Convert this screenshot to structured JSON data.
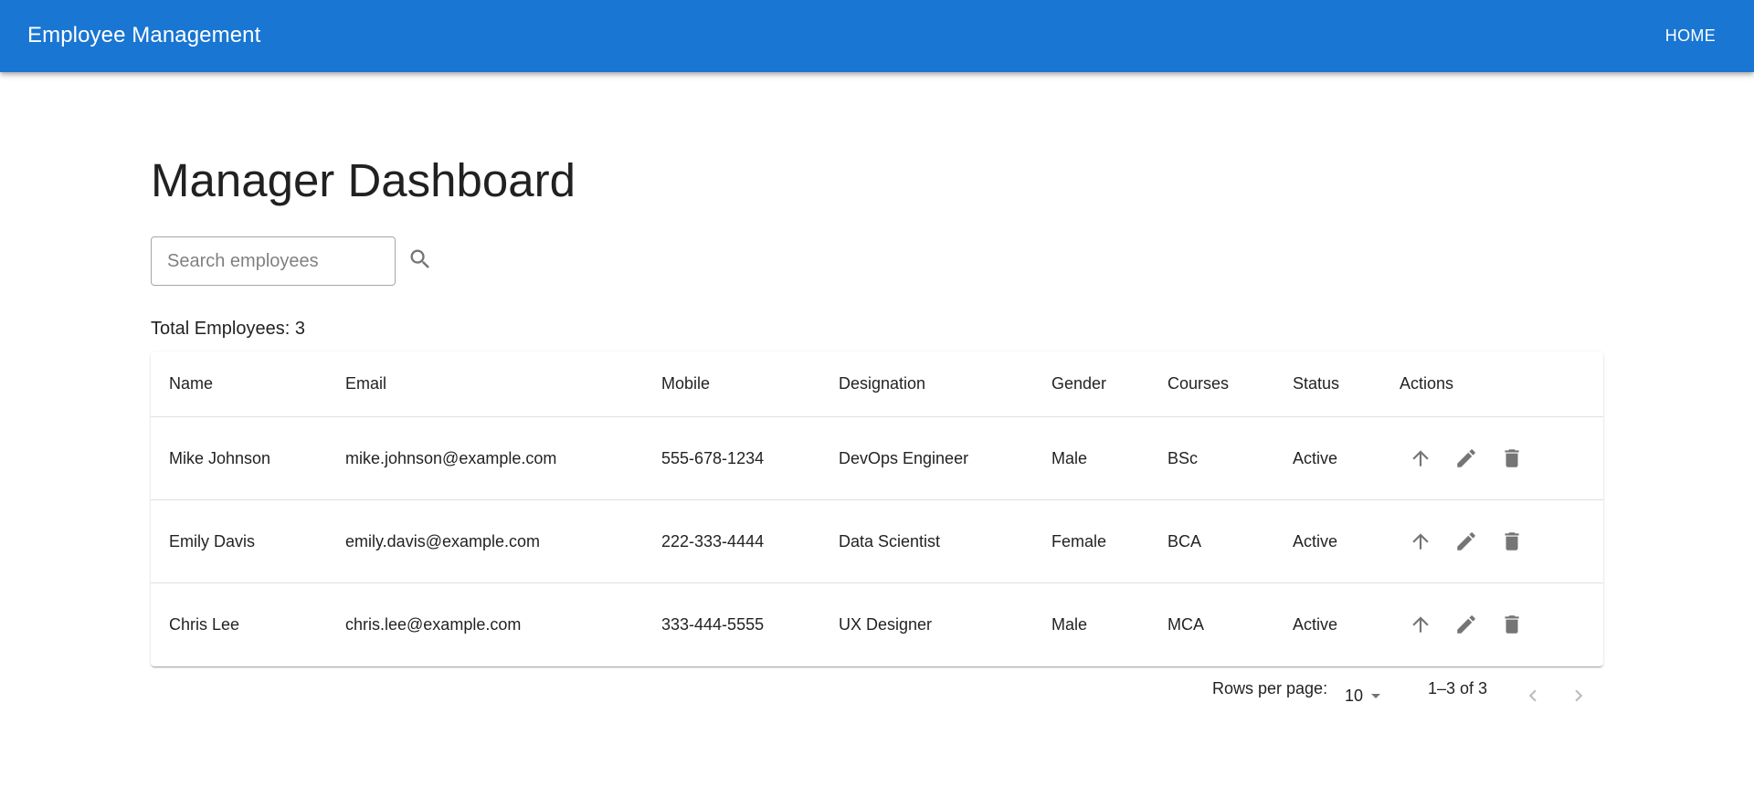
{
  "appbar": {
    "title": "Employee Management",
    "home_label": "HOME",
    "color": "#1976d2"
  },
  "page": {
    "title": "Manager Dashboard"
  },
  "search": {
    "placeholder": "Search employees",
    "value": "",
    "icon": "search-icon"
  },
  "summary": {
    "total_label": "Total Employees: 3"
  },
  "table": {
    "headers": {
      "name": "Name",
      "email": "Email",
      "mobile": "Mobile",
      "designation": "Designation",
      "gender": "Gender",
      "courses": "Courses",
      "status": "Status",
      "actions": "Actions"
    },
    "rows": [
      {
        "name": "Mike Johnson",
        "email": "mike.johnson@example.com",
        "mobile": "555-678-1234",
        "designation": "DevOps Engineer",
        "gender": "Male",
        "courses": "BSc",
        "status": "Active"
      },
      {
        "name": "Emily Davis",
        "email": "emily.davis@example.com",
        "mobile": "222-333-4444",
        "designation": "Data Scientist",
        "gender": "Female",
        "courses": "BCA",
        "status": "Active"
      },
      {
        "name": "Chris Lee",
        "email": "chris.lee@example.com",
        "mobile": "333-444-5555",
        "designation": "UX Designer",
        "gender": "Male",
        "courses": "MCA",
        "status": "Active"
      }
    ],
    "action_icons": [
      "arrow-upward-icon",
      "edit-icon",
      "delete-icon"
    ]
  },
  "pagination": {
    "rows_per_page_label": "Rows per page:",
    "rows_per_page_value": "10",
    "range_label": "1–3 of 3",
    "prev_icon": "chevron-left-icon",
    "next_icon": "chevron-right-icon"
  }
}
